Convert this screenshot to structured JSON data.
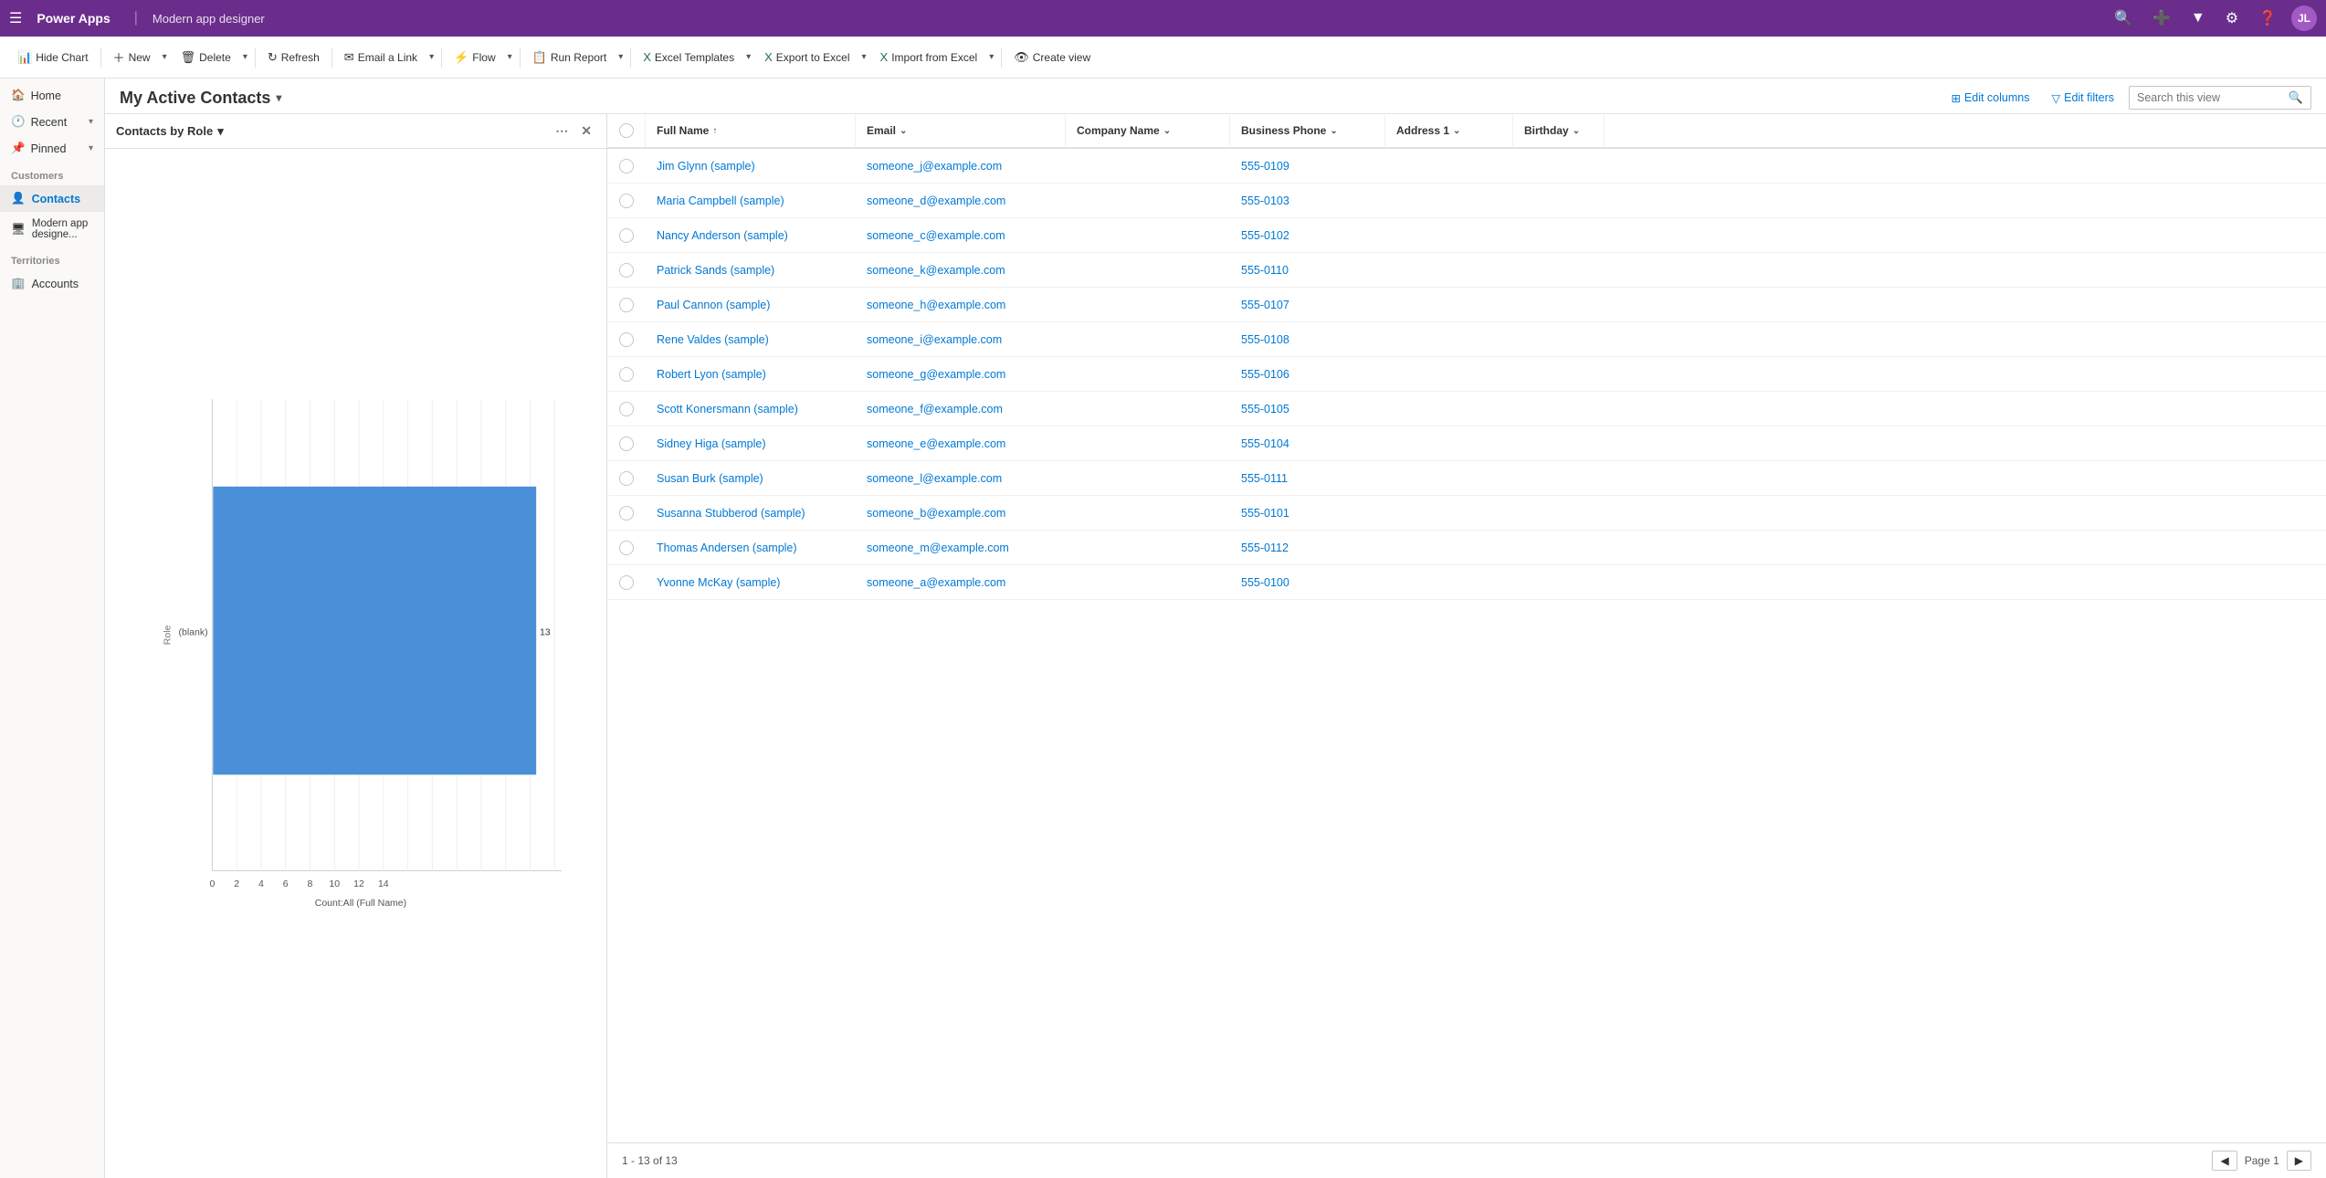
{
  "topbar": {
    "app_name": "Power Apps",
    "separator": "|",
    "page_title": "Modern app designer",
    "icons": [
      "search",
      "add",
      "filter",
      "settings",
      "help",
      "user"
    ]
  },
  "toolbar": {
    "buttons": [
      {
        "id": "hide-chart",
        "icon": "📊",
        "label": "Hide Chart",
        "has_dropdown": false
      },
      {
        "id": "new",
        "icon": "+",
        "label": "New",
        "has_dropdown": true
      },
      {
        "id": "delete",
        "icon": "🗑",
        "label": "Delete",
        "has_dropdown": true
      },
      {
        "id": "refresh",
        "icon": "↻",
        "label": "Refresh",
        "has_dropdown": false
      },
      {
        "id": "email-link",
        "icon": "✉",
        "label": "Email a Link",
        "has_dropdown": true
      },
      {
        "id": "flow",
        "icon": "⚡",
        "label": "Flow",
        "has_dropdown": true
      },
      {
        "id": "run-report",
        "icon": "📋",
        "label": "Run Report",
        "has_dropdown": true
      },
      {
        "id": "excel-templates",
        "icon": "📗",
        "label": "Excel Templates",
        "has_dropdown": true
      },
      {
        "id": "export-excel",
        "icon": "📗",
        "label": "Export to Excel",
        "has_dropdown": true
      },
      {
        "id": "import-excel",
        "icon": "📗",
        "label": "Import from Excel",
        "has_dropdown": true
      },
      {
        "id": "create-view",
        "icon": "👁",
        "label": "Create view",
        "has_dropdown": false
      }
    ]
  },
  "sidebar": {
    "sections": [
      {
        "type": "group",
        "label": "Home",
        "icon": "🏠",
        "expanded": false
      },
      {
        "type": "group",
        "label": "Recent",
        "icon": "🕐",
        "expanded": false
      },
      {
        "type": "group",
        "label": "Pinned",
        "icon": "📌",
        "expanded": false
      },
      {
        "type": "section-label",
        "label": "Customers"
      },
      {
        "type": "item",
        "label": "Contacts",
        "icon": "👤",
        "active": true
      },
      {
        "type": "item",
        "label": "Modern app designe...",
        "icon": "🖥",
        "active": false
      },
      {
        "type": "section-label",
        "label": "Territories"
      },
      {
        "type": "item",
        "label": "Accounts",
        "icon": "🏢",
        "active": false
      }
    ]
  },
  "view": {
    "title": "My Active Contacts",
    "title_chev": "▾",
    "edit_columns_label": "Edit columns",
    "edit_filters_label": "Edit filters",
    "search_placeholder": "Search this view"
  },
  "chart": {
    "title": "Contacts by Role",
    "title_chev": "▾",
    "bar_data": [
      {
        "label": "(blank)",
        "value": 13,
        "max": 13
      }
    ],
    "x_axis_label": "Count:All (Full Name)",
    "x_ticks": [
      0,
      2,
      4,
      6,
      8,
      10,
      12,
      14
    ],
    "y_label": "Role"
  },
  "grid": {
    "columns": [
      {
        "id": "check",
        "label": "",
        "type": "check"
      },
      {
        "id": "fullname",
        "label": "Full Name",
        "sortable": true,
        "sort": "asc"
      },
      {
        "id": "email",
        "label": "Email",
        "sortable": true
      },
      {
        "id": "company",
        "label": "Company Name",
        "sortable": true
      },
      {
        "id": "phone",
        "label": "Business Phone",
        "sortable": true
      },
      {
        "id": "address",
        "label": "Address 1",
        "sortable": true
      },
      {
        "id": "birthday",
        "label": "Birthday",
        "sortable": true
      }
    ],
    "rows": [
      {
        "fullname": "Jim Glynn (sample)",
        "email": "someone_j@example.com",
        "company": "",
        "phone": "555-0109",
        "address": "",
        "birthday": ""
      },
      {
        "fullname": "Maria Campbell (sample)",
        "email": "someone_d@example.com",
        "company": "",
        "phone": "555-0103",
        "address": "",
        "birthday": ""
      },
      {
        "fullname": "Nancy Anderson (sample)",
        "email": "someone_c@example.com",
        "company": "",
        "phone": "555-0102",
        "address": "",
        "birthday": ""
      },
      {
        "fullname": "Patrick Sands (sample)",
        "email": "someone_k@example.com",
        "company": "",
        "phone": "555-0110",
        "address": "",
        "birthday": ""
      },
      {
        "fullname": "Paul Cannon (sample)",
        "email": "someone_h@example.com",
        "company": "",
        "phone": "555-0107",
        "address": "",
        "birthday": ""
      },
      {
        "fullname": "Rene Valdes (sample)",
        "email": "someone_i@example.com",
        "company": "",
        "phone": "555-0108",
        "address": "",
        "birthday": ""
      },
      {
        "fullname": "Robert Lyon (sample)",
        "email": "someone_g@example.com",
        "company": "",
        "phone": "555-0106",
        "address": "",
        "birthday": ""
      },
      {
        "fullname": "Scott Konersmann (sample)",
        "email": "someone_f@example.com",
        "company": "",
        "phone": "555-0105",
        "address": "",
        "birthday": ""
      },
      {
        "fullname": "Sidney Higa (sample)",
        "email": "someone_e@example.com",
        "company": "",
        "phone": "555-0104",
        "address": "",
        "birthday": ""
      },
      {
        "fullname": "Susan Burk (sample)",
        "email": "someone_l@example.com",
        "company": "",
        "phone": "555-0111",
        "address": "",
        "birthday": ""
      },
      {
        "fullname": "Susanna Stubberod (sample)",
        "email": "someone_b@example.com",
        "company": "",
        "phone": "555-0101",
        "address": "",
        "birthday": ""
      },
      {
        "fullname": "Thomas Andersen (sample)",
        "email": "someone_m@example.com",
        "company": "",
        "phone": "555-0112",
        "address": "",
        "birthday": ""
      },
      {
        "fullname": "Yvonne McKay (sample)",
        "email": "someone_a@example.com",
        "company": "",
        "phone": "555-0100",
        "address": "",
        "birthday": ""
      }
    ],
    "footer": {
      "range": "1 - 13 of 13",
      "page_label": "Page 1"
    }
  },
  "colors": {
    "topbar_bg": "#6b2d8b",
    "accent": "#0078d4",
    "bar_color": "#4a90d9"
  }
}
